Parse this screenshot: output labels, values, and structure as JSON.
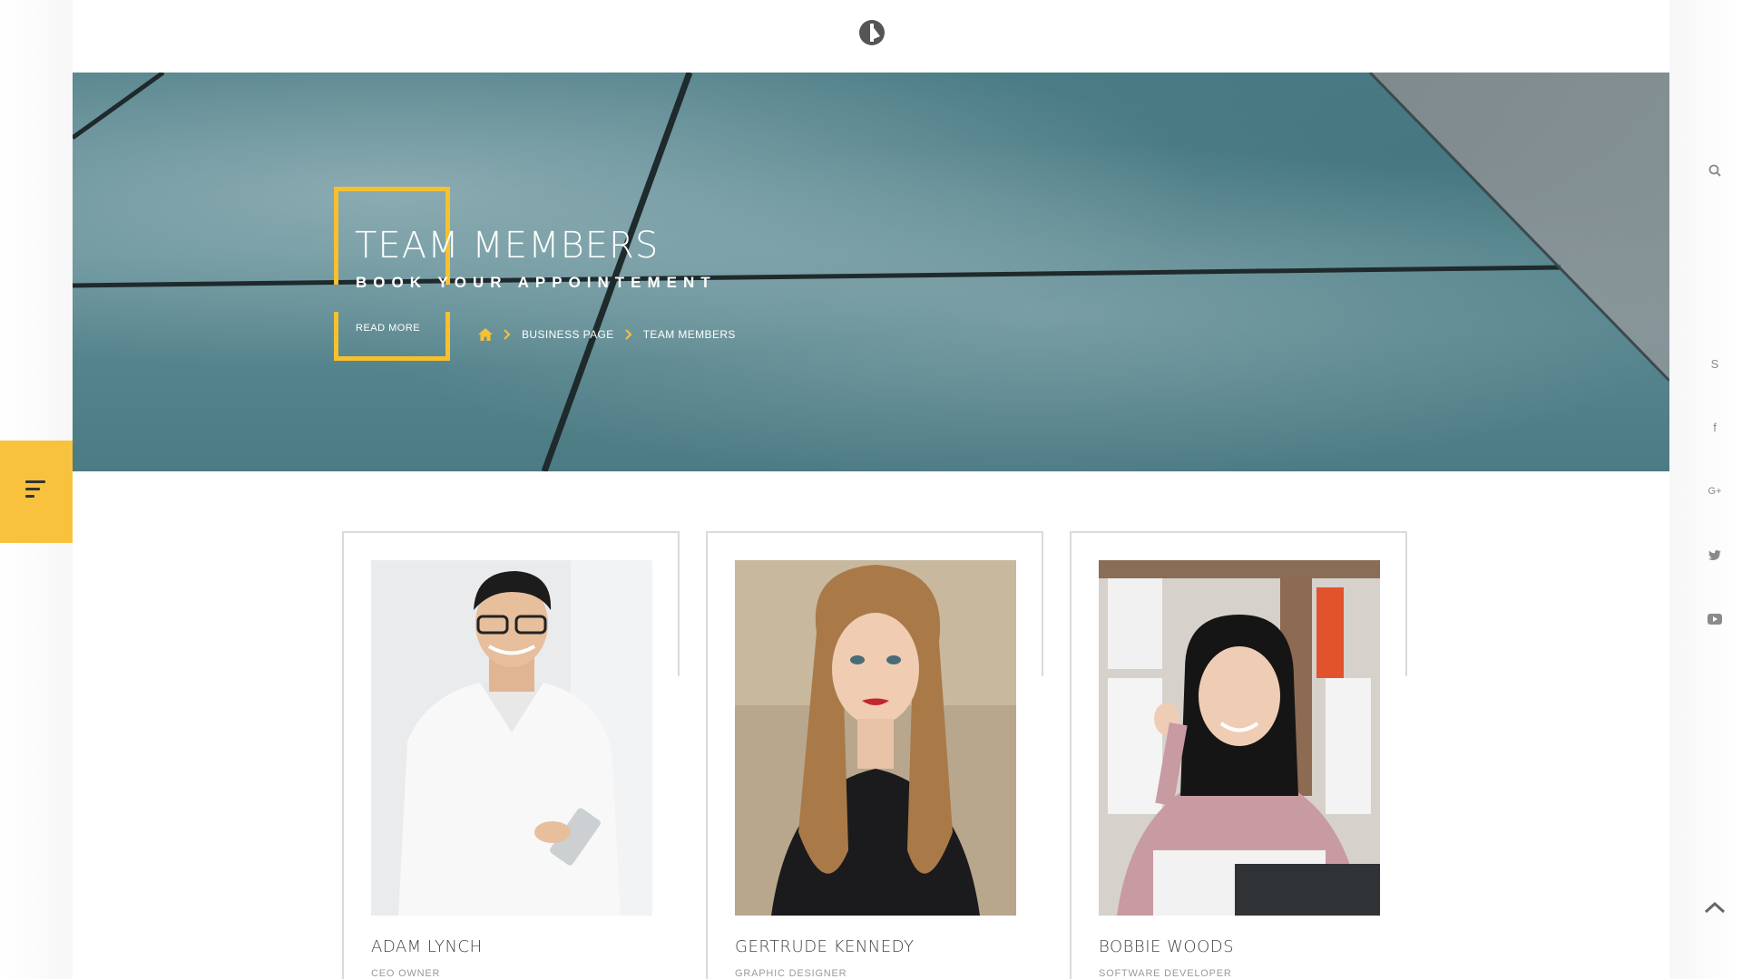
{
  "hero": {
    "title": "TEAM MEMBERS",
    "subtitle": "BOOK YOUR APPOINTEMENT",
    "read_more": "READ MORE"
  },
  "breadcrumb": {
    "items": [
      "BUSINESS PAGE",
      "TEAM MEMBERS"
    ],
    "home_icon": "home-icon",
    "separator_icon": "chevron-right-icon"
  },
  "team": [
    {
      "name": "ADAM LYNCH",
      "role": "CEO OWNER"
    },
    {
      "name": "GERTRUDE KENNEDY",
      "role": "GRAPHIC DESIGNER"
    },
    {
      "name": "BOBBIE WOODS",
      "role": "SOFTWARE DEVELOPER"
    }
  ],
  "social": {
    "icons": [
      "search-icon",
      "skype-icon",
      "facebook-icon",
      "google-plus-icon",
      "twitter-icon",
      "youtube-icon"
    ],
    "glyphs": {
      "skype": "S",
      "facebook": "f",
      "google_plus": "G+"
    }
  },
  "colors": {
    "accent": "#f8c23f",
    "frame": "#f6c02f",
    "hero": "#4f7f88"
  }
}
